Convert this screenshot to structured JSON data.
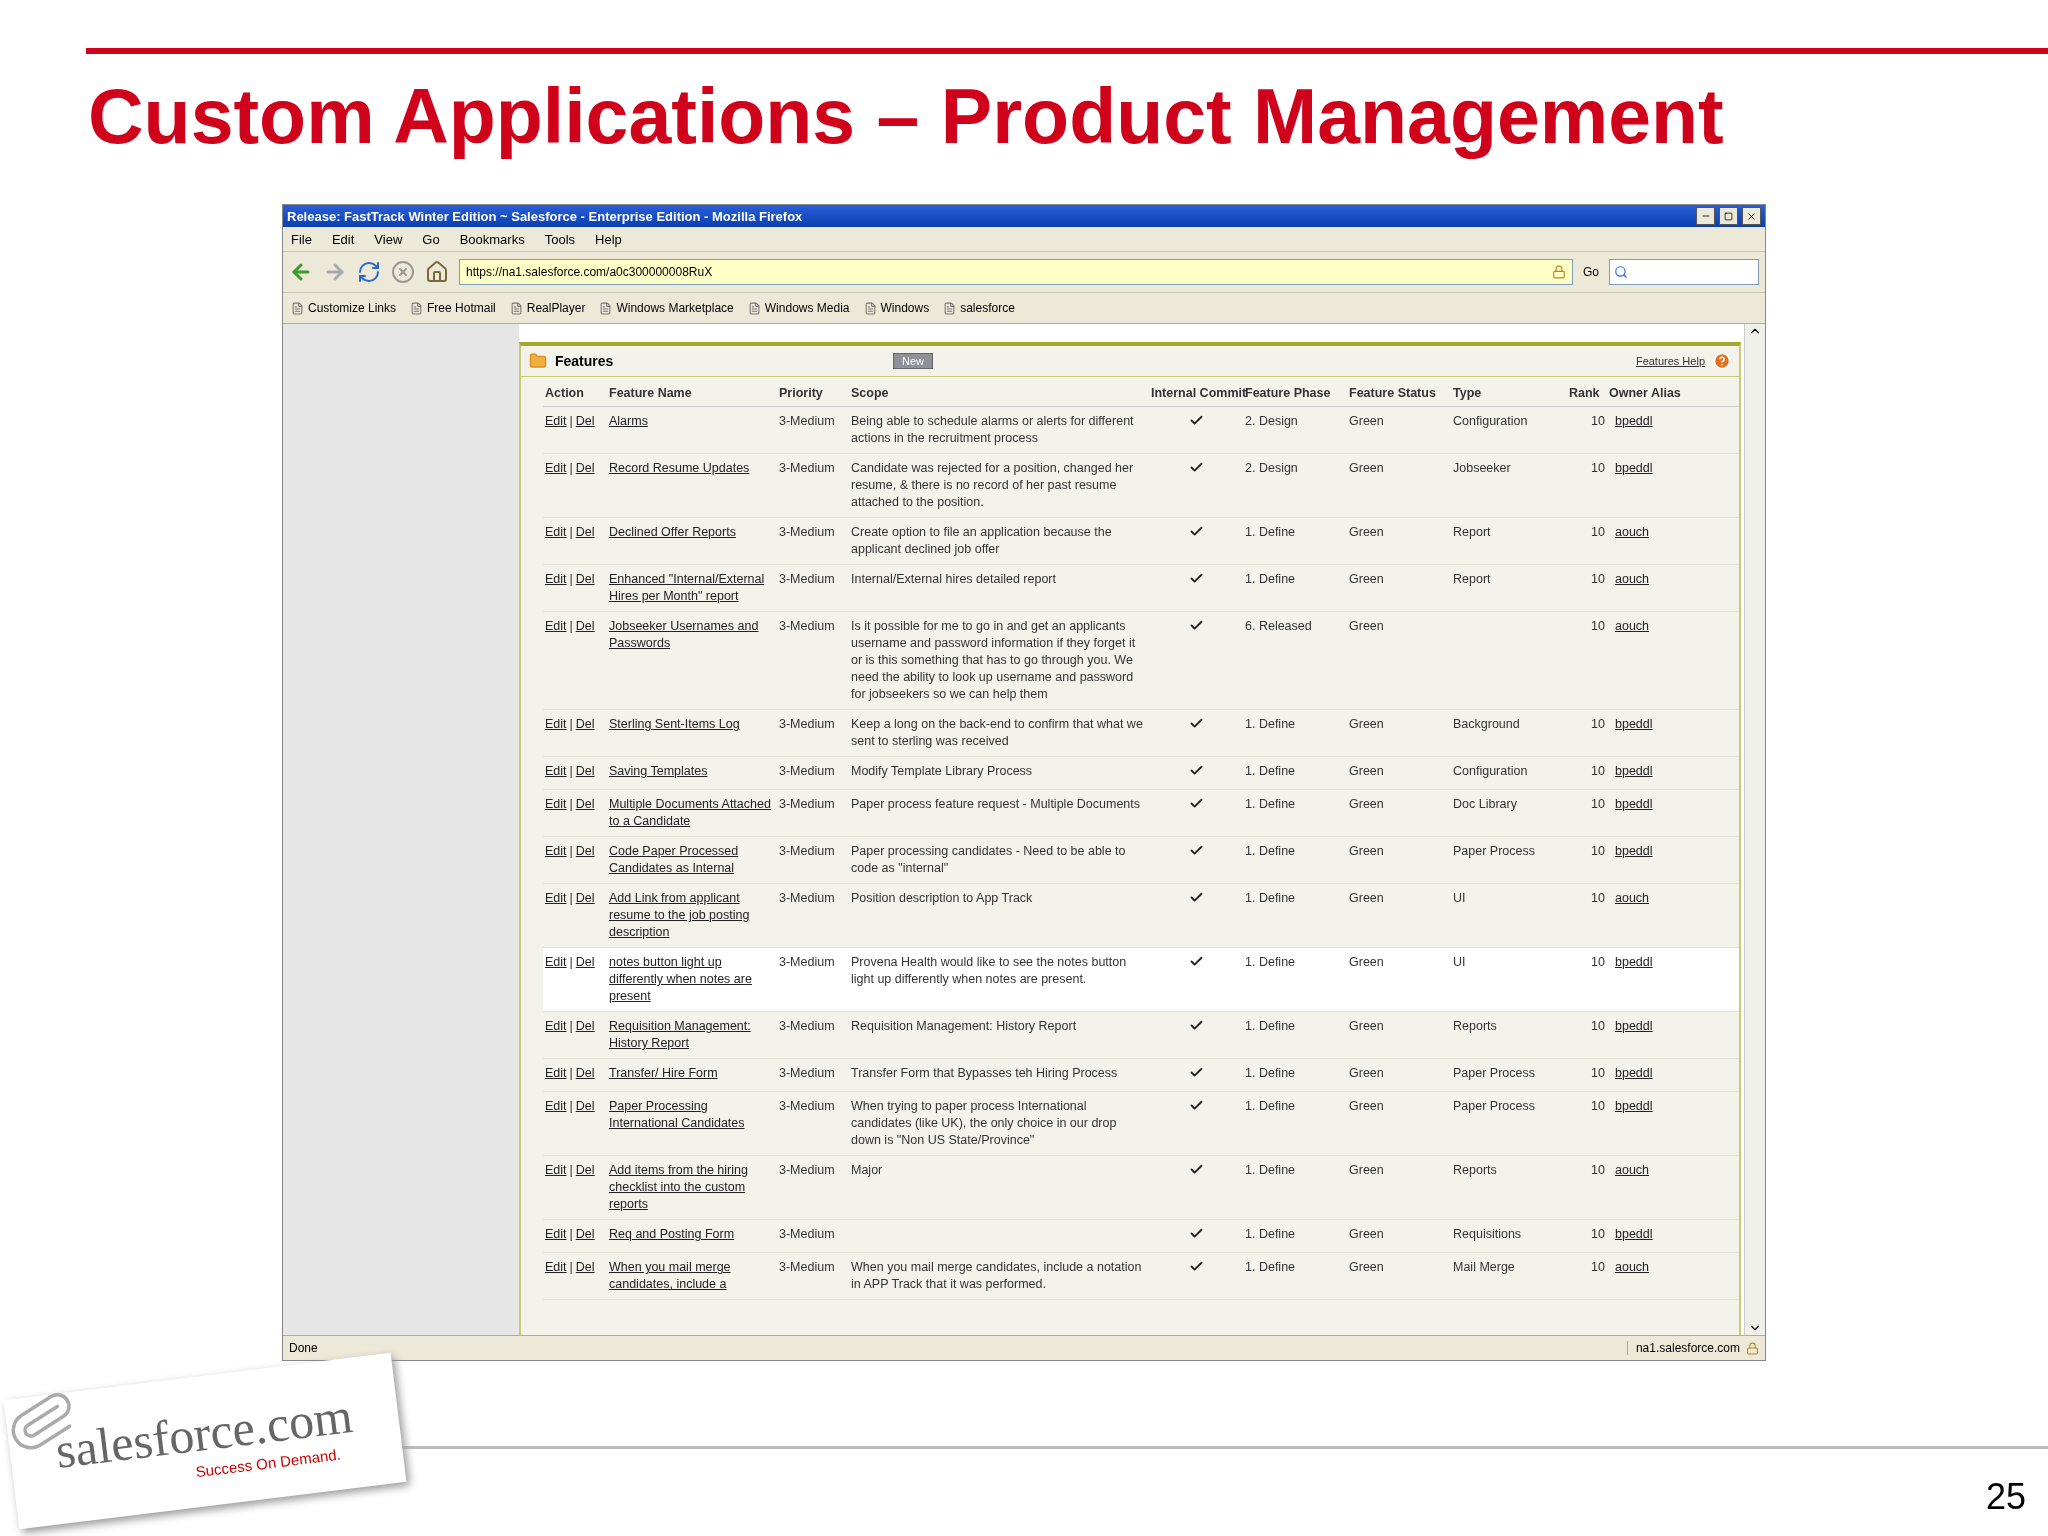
{
  "slide": {
    "title": "Custom Applications – Product Management",
    "page_number": "25",
    "logo": {
      "brand": "salesforce.com",
      "tagline": "Success On Demand."
    }
  },
  "browser": {
    "title": "Release: FastTrack Winter Edition ~ Salesforce - Enterprise Edition - Mozilla Firefox",
    "menu": [
      "File",
      "Edit",
      "View",
      "Go",
      "Bookmarks",
      "Tools",
      "Help"
    ],
    "url": "https://na1.salesforce.com/a0c300000008RuX",
    "go_label": "Go",
    "bookmarks": [
      "Customize Links",
      "Free Hotmail",
      "RealPlayer",
      "Windows Marketplace",
      "Windows Media",
      "Windows",
      "salesforce"
    ],
    "status": "Done",
    "status_host": "na1.salesforce.com"
  },
  "panel": {
    "title": "Features",
    "new_button": "New",
    "help_link": "Features Help",
    "columns": [
      "Action",
      "Feature Name",
      "Priority",
      "Scope",
      "Internal Commit",
      "Feature Phase",
      "Feature Status",
      "Type",
      "Rank",
      "Owner Alias"
    ],
    "rows": [
      {
        "edit": "Edit",
        "sep": "|",
        "del": "Del",
        "name": "Alarms",
        "priority": "3-Medium",
        "scope": "Being able to schedule alarms or alerts for different actions in the recruitment process",
        "committed": true,
        "phase": "2. Design",
        "status": "Green",
        "type": "Configuration",
        "rank": "10",
        "owner": "bpeddl",
        "selected": false
      },
      {
        "edit": "Edit",
        "sep": "|",
        "del": "Del",
        "name": "Record Resume Updates",
        "priority": "3-Medium",
        "scope": "Candidate was rejected for a position, changed her resume, & there is no record of her past resume attached to the position.",
        "committed": true,
        "phase": "2. Design",
        "status": "Green",
        "type": "Jobseeker",
        "rank": "10",
        "owner": "bpeddl",
        "selected": false
      },
      {
        "edit": "Edit",
        "sep": "|",
        "del": "Del",
        "name": "Declined Offer Reports",
        "priority": "3-Medium",
        "scope": "Create option to file an application because the applicant declined job offer",
        "committed": true,
        "phase": "1. Define",
        "status": "Green",
        "type": "Report",
        "rank": "10",
        "owner": "aouch",
        "selected": false
      },
      {
        "edit": "Edit",
        "sep": "|",
        "del": "Del",
        "name": "Enhanced \"Internal/External Hires per Month\" report",
        "priority": "3-Medium",
        "scope": "Internal/External hires detailed report",
        "committed": true,
        "phase": "1. Define",
        "status": "Green",
        "type": "Report",
        "rank": "10",
        "owner": "aouch",
        "selected": false
      },
      {
        "edit": "Edit",
        "sep": "|",
        "del": "Del",
        "name": "Jobseeker Usernames and Passwords",
        "priority": "3-Medium",
        "scope": "Is it possible for me to go in and get an applicants username and password information if they forget it or is this something that has to go through you. We need the ability to look up username and password for jobseekers so we can help them",
        "committed": true,
        "phase": "6. Released",
        "status": "Green",
        "rank": "10",
        "owner": "aouch",
        "selected": false
      },
      {
        "edit": "Edit",
        "sep": "|",
        "del": "Del",
        "name": "Sterling Sent-Items Log",
        "priority": "3-Medium",
        "scope": "Keep a long on the back-end to confirm that what we sent to sterling was received",
        "committed": true,
        "phase": "1. Define",
        "status": "Green",
        "type": "Background",
        "rank": "10",
        "owner": "bpeddl",
        "selected": false
      },
      {
        "edit": "Edit",
        "sep": "|",
        "del": "Del",
        "name": "Saving Templates",
        "priority": "3-Medium",
        "scope": "Modify Template Library Process",
        "committed": true,
        "phase": "1. Define",
        "status": "Green",
        "type": "Configuration",
        "rank": "10",
        "owner": "bpeddl",
        "selected": false
      },
      {
        "edit": "Edit",
        "sep": "|",
        "del": "Del",
        "name": "Multiple Documents Attached to a Candidate",
        "priority": "3-Medium",
        "scope": "Paper process feature request - Multiple Documents",
        "committed": true,
        "phase": "1. Define",
        "status": "Green",
        "type": "Doc Library",
        "rank": "10",
        "owner": "bpeddl",
        "selected": false
      },
      {
        "edit": "Edit",
        "sep": "|",
        "del": "Del",
        "name": "Code Paper Processed Candidates as Internal",
        "priority": "3-Medium",
        "scope": "Paper processing candidates - Need to be able to code as \"internal\"",
        "committed": true,
        "phase": "1. Define",
        "status": "Green",
        "type": "Paper Process",
        "rank": "10",
        "owner": "bpeddl",
        "selected": false
      },
      {
        "edit": "Edit",
        "sep": "|",
        "del": "Del",
        "name": "Add Link from applicant resume to the job posting description",
        "priority": "3-Medium",
        "scope": "Position description to App Track",
        "committed": true,
        "phase": "1. Define",
        "status": "Green",
        "type": "UI",
        "rank": "10",
        "owner": "aouch",
        "selected": false
      },
      {
        "edit": "Edit",
        "sep": "|",
        "del": "Del",
        "name": "notes button light up differently when notes are present",
        "priority": "3-Medium",
        "scope": "Provena Health would like to see the notes button light up differently when notes are present.",
        "committed": true,
        "phase": "1. Define",
        "status": "Green",
        "type": "UI",
        "rank": "10",
        "owner": "bpeddl",
        "selected": true
      },
      {
        "edit": "Edit",
        "sep": "|",
        "del": "Del",
        "name": "Requisition Management: History Report",
        "priority": "3-Medium",
        "scope": "Requisition Management: History Report",
        "committed": true,
        "phase": "1. Define",
        "status": "Green",
        "type": "Reports",
        "rank": "10",
        "owner": "bpeddl",
        "selected": false
      },
      {
        "edit": "Edit",
        "sep": "|",
        "del": "Del",
        "name": "Transfer/ Hire Form",
        "priority": "3-Medium",
        "scope": "Transfer Form that Bypasses teh Hiring Process",
        "committed": true,
        "phase": "1. Define",
        "status": "Green",
        "type": "Paper Process",
        "rank": "10",
        "owner": "bpeddl",
        "selected": false
      },
      {
        "edit": "Edit",
        "sep": "|",
        "del": "Del",
        "name": "Paper Processing International Candidates",
        "priority": "3-Medium",
        "scope": "When trying to paper process International candidates (like UK), the only choice in our drop down is \"Non US State/Province\"",
        "committed": true,
        "phase": "1. Define",
        "status": "Green",
        "type": "Paper Process",
        "rank": "10",
        "owner": "bpeddl",
        "selected": false
      },
      {
        "edit": "Edit",
        "sep": "|",
        "del": "Del",
        "name": "Add items from the hiring checklist into the custom reports",
        "priority": "3-Medium",
        "scope": "Major",
        "committed": true,
        "phase": "1. Define",
        "status": "Green",
        "type": "Reports",
        "rank": "10",
        "owner": "aouch",
        "selected": false
      },
      {
        "edit": "Edit",
        "sep": "|",
        "del": "Del",
        "name": "Req and Posting Form",
        "priority": "3-Medium",
        "committed": true,
        "phase": "1. Define",
        "status": "Green",
        "type": "Requisitions",
        "rank": "10",
        "owner": "bpeddl",
        "selected": false
      },
      {
        "edit": "Edit",
        "sep": "|",
        "del": "Del",
        "name": "When you mail merge candidates, include a",
        "priority": "3-Medium",
        "scope": "When you mail merge candidates, include a notation in APP Track that it was performed.",
        "committed": true,
        "phase": "1. Define",
        "status": "Green",
        "type": "Mail Merge",
        "rank": "10",
        "owner": "aouch",
        "selected": false
      }
    ]
  }
}
